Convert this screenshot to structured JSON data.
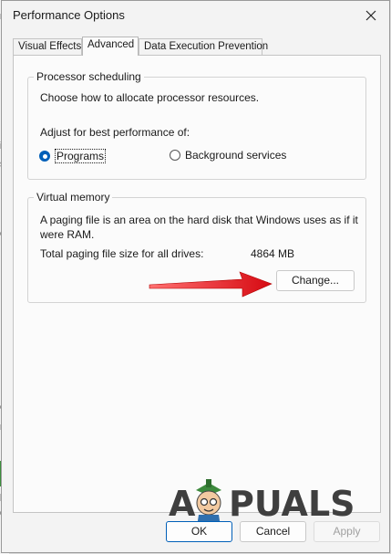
{
  "window": {
    "title": "Performance Options"
  },
  "tabs": [
    {
      "label": "Visual Effects"
    },
    {
      "label": "Advanced"
    },
    {
      "label": "Data Execution Prevention"
    }
  ],
  "processor": {
    "title": "Processor scheduling",
    "description": "Choose how to allocate processor resources.",
    "adjust_label": "Adjust for best performance of:",
    "options": [
      {
        "label": "Programs",
        "selected": true
      },
      {
        "label": "Background services",
        "selected": false
      }
    ]
  },
  "virtual_memory": {
    "title": "Virtual memory",
    "description": "A paging file is an area on the hard disk that Windows uses as if it were RAM.",
    "total_label": "Total paging file size for all drives:",
    "total_value": "4864 MB",
    "change_label": "Change..."
  },
  "footer": {
    "ok_label": "OK",
    "cancel_label": "Cancel",
    "apply_label": "Apply"
  },
  "watermark": {
    "text_left": "A",
    "text_right": "PUALS"
  },
  "colors": {
    "accent": "#005fb8",
    "arrow": "#e8141c"
  }
}
